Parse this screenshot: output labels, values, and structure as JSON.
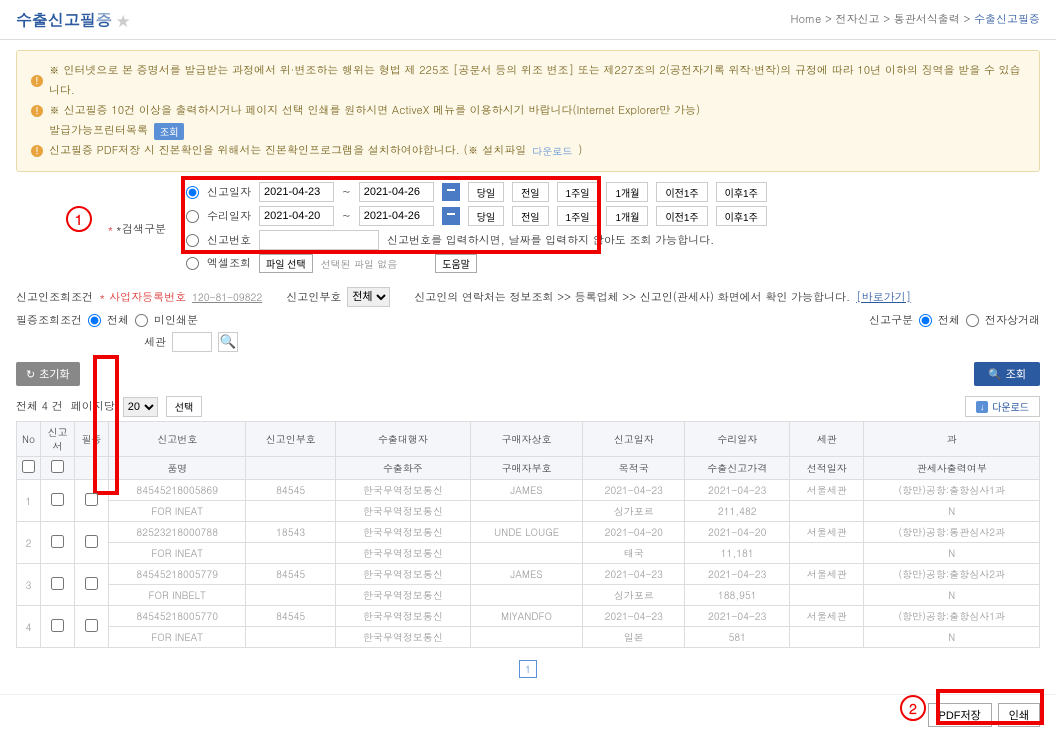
{
  "header": {
    "title": "수출신고필증",
    "breadcrumb": {
      "home": "Home",
      "p1": "전자신고",
      "p2": "통관서식출력",
      "current": "수출신고필증"
    }
  },
  "notices": {
    "n1": "※ 인터넷으로 본 증명서를 발급받는 과정에서 위·변조하는 행위는 형법 제 225조 [공문서 등의 위조 변조] 또는 제227조의 2(공전자기록 위작·변작)의 규정에 따라 10년 이하의 징역을 받을 수 있습니다.",
    "n2": "※ 신고필증 10건 이상을 출력하시거나 페이지 선택 인쇄를 원하시면 ActiveX 메뉴를 이용하시기 바랍니다(Internet Explorer만 가능)",
    "n2b": "발급가능프린터목록",
    "n2btn": "조회",
    "n3": "신고필증 PDF저장 시 진본확인을 위해서는 진본확인프로그램을 설치하여야합니다. (※ 설치파일",
    "n3link": "다운로드",
    "n3close": ")"
  },
  "search": {
    "group_label": "*검색구분",
    "r1_label": "신고일자",
    "r2_label": "수리일자",
    "r3_label": "신고번호",
    "r3_hint": "신고번호를 입력하시면, 날짜를 입력하지 않아도 조회 가능합니다.",
    "r4_label": "엑셀조회",
    "d1a": "2021-04-23",
    "d1b": "2021-04-26",
    "d2a": "2021-04-20",
    "d2b": "2021-04-26",
    "tilde": "~",
    "btns": [
      "당일",
      "전일",
      "1주일",
      "1개월",
      "이전1주",
      "이후1주"
    ],
    "file_select": "파일 선택",
    "file_none": "선택된 파일 없음",
    "file_upload": "도움말",
    "circle1": "1"
  },
  "sub": {
    "l1": "신고인조회조건",
    "v1": "* 사업자등록번호",
    "v1num": "120-81-09822",
    "l2": "신고인부호",
    "v2opt": "전체",
    "hint": "신고인의 연락처는 정보조회 >> 등록업체 >> 신고인(관세사) 화면에서 확인 가능합니다.",
    "link": "[바로가기]",
    "l3": "필증조회조건",
    "o3a": "전체",
    "o3b": "미인쇄분",
    "l4": "신고구분",
    "o4a": "전체",
    "o4b": "전자상거래",
    "l5": "세관"
  },
  "actions": {
    "reset": "초기화",
    "query": "조회"
  },
  "controls": {
    "total": "전체 4 건",
    "perpage_label": "페이지당",
    "perpage": "20",
    "select": "선택",
    "download": "다운로드"
  },
  "table": {
    "h": [
      "No",
      "신고서",
      "필증",
      "신고번호",
      "신고인부호",
      "수출대행자",
      "구매자상호",
      "신고일자",
      "수리일자",
      "세관",
      "과"
    ],
    "h2": [
      "",
      "",
      "",
      "품명",
      "",
      "수출화주",
      "구매자부호",
      "목적국",
      "수출신고가격",
      "선적일자",
      "관세사출력여부"
    ],
    "rows": [
      {
        "no": "1",
        "c1": "84545218005869",
        "c2": "84545",
        "c3": "한국무역정보통신",
        "c4": "JAMES",
        "c5": "2021-04-23",
        "c6": "2021-04-23",
        "c7": "서울세관",
        "c8": "(항만)공항:출항심사1과"
      },
      {
        "sub": true,
        "c1": "FOR INEAT",
        "c2": "",
        "c3": "한국무역정보통신",
        "c4": "",
        "c5": "싱가포르",
        "c6": "211,482",
        "c7": "",
        "c8": "N"
      },
      {
        "no": "2",
        "c1": "82523218000788",
        "c2": "18543",
        "c3": "한국무역정보통신",
        "c4": "UNDE LOUGE",
        "c5": "2021-04-20",
        "c6": "2021-04-20",
        "c7": "서울세관",
        "c8": "(항만)공항:통관심사2과"
      },
      {
        "sub": true,
        "c1": "FOR INEAT",
        "c2": "",
        "c3": "한국무역정보통신",
        "c4": "",
        "c5": "태국",
        "c6": "11,181",
        "c7": "",
        "c8": "N"
      },
      {
        "no": "3",
        "c1": "84545218005779",
        "c2": "84545",
        "c3": "한국무역정보통신",
        "c4": "JAMES",
        "c5": "2021-04-23",
        "c6": "2021-04-23",
        "c7": "서울세관",
        "c8": "(항만)공항:출항심사2과"
      },
      {
        "sub": true,
        "c1": "FOR INBELT",
        "c2": "",
        "c3": "한국무역정보통신",
        "c4": "",
        "c5": "싱가포르",
        "c6": "188,951",
        "c7": "",
        "c8": "N"
      },
      {
        "no": "4",
        "c1": "84545218005770",
        "c2": "84545",
        "c3": "한국무역정보통신",
        "c4": "MIYANDFO",
        "c5": "2021-04-23",
        "c6": "2021-04-23",
        "c7": "서울세관",
        "c8": "(항만)공항:출항심사1과"
      },
      {
        "sub": true,
        "c1": "FOR INEAT",
        "c2": "",
        "c3": "한국무역정보통신",
        "c4": "",
        "c5": "일본",
        "c6": "581",
        "c7": "",
        "c8": "N"
      }
    ]
  },
  "pagination": {
    "p1": "1"
  },
  "footer": {
    "pdf": "PDF저장",
    "print": "인쇄",
    "circle2": "2"
  }
}
